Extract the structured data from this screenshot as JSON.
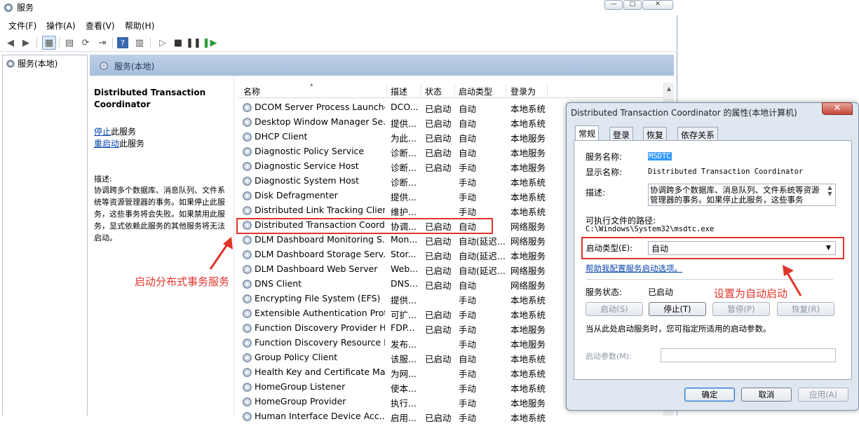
{
  "window": {
    "title": "服务",
    "buttons": [
      "—",
      "□",
      "✕"
    ]
  },
  "menu": [
    "文件(F)",
    "操作(A)",
    "查看(V)",
    "帮助(H)"
  ],
  "tree": {
    "root": "服务(本地)"
  },
  "content_header": "服务(本地)",
  "selected_service": {
    "title": "Distributed Transaction Coordinator",
    "stop_link": "停止",
    "stop_suffix": "此服务",
    "restart_link": "重启动",
    "restart_suffix": "此服务",
    "desc_label": "描述:",
    "desc_text": "协调跨多个数据库、消息队列、文件系统等资源管理器的事务。如果停止此服务，这些事务将会失败。如果禁用此服务，显式依赖此服务的其他服务将无法启动。"
  },
  "list": {
    "columns": [
      "名称",
      "描述",
      "状态",
      "启动类型",
      "登录为"
    ],
    "rows": [
      [
        "DCOM Server Process Launcher",
        "DCO...",
        "已启动",
        "自动",
        "本地系统"
      ],
      [
        "Desktop Window Manager Se...",
        "提供...",
        "已启动",
        "自动",
        "本地系统"
      ],
      [
        "DHCP Client",
        "为此...",
        "已启动",
        "自动",
        "本地服务"
      ],
      [
        "Diagnostic Policy Service",
        "诊断...",
        "已启动",
        "自动",
        "本地服务"
      ],
      [
        "Diagnostic Service Host",
        "诊断...",
        "已启动",
        "手动",
        "本地服务"
      ],
      [
        "Diagnostic System Host",
        "诊断...",
        "",
        "手动",
        "本地系统"
      ],
      [
        "Disk Defragmenter",
        "提供...",
        "",
        "手动",
        "本地系统"
      ],
      [
        "Distributed Link Tracking Client",
        "维护...",
        "",
        "手动",
        "本地系统"
      ],
      [
        "Distributed Transaction Coord...",
        "协调...",
        "已启动",
        "自动",
        "网络服务"
      ],
      [
        "DLM Dashboard Monitoring S...",
        "Mon...",
        "已启动",
        "自动(延迟...",
        "网络服务"
      ],
      [
        "DLM Dashboard Storage Serv...",
        "Stor...",
        "已启动",
        "自动(延迟...",
        "本地服务"
      ],
      [
        "DLM Dashboard Web Server",
        "Web...",
        "已启动",
        "自动(延迟...",
        "网络服务"
      ],
      [
        "DNS Client",
        "DNS...",
        "已启动",
        "自动",
        "网络服务"
      ],
      [
        "Encrypting File System (EFS)",
        "提供...",
        "",
        "手动",
        "本地系统"
      ],
      [
        "Extensible Authentication Prot...",
        "可扩...",
        "已启动",
        "手动",
        "本地系统"
      ],
      [
        "Function Discovery Provider H...",
        "FDP...",
        "已启动",
        "手动",
        "本地服务"
      ],
      [
        "Function Discovery Resource P...",
        "发布...",
        "",
        "手动",
        "本地服务"
      ],
      [
        "Group Policy Client",
        "该服...",
        "已启动",
        "自动",
        "本地系统"
      ],
      [
        "Health Key and Certificate Ma...",
        "为网...",
        "",
        "手动",
        "本地系统"
      ],
      [
        "HomeGroup Listener",
        "使本...",
        "",
        "手动",
        "本地系统"
      ],
      [
        "HomeGroup Provider",
        "执行...",
        "",
        "手动",
        "本地服务"
      ],
      [
        "Human Interface Device Acc...",
        "启用...",
        "已启动",
        "手动",
        "本地系统"
      ]
    ]
  },
  "annotation_left": "启动分布式事务服务",
  "annotation_right": "设置为自动启动",
  "dialog": {
    "title": "Distributed Transaction Coordinator 的属性(本地计算机)",
    "close": "✕",
    "tabs": [
      "常规",
      "登录",
      "恢复",
      "依存关系"
    ],
    "service_name_label": "服务名称:",
    "service_name": "MSDTC",
    "display_name_label": "显示名称:",
    "display_name": "Distributed Transaction Coordinator",
    "desc_label": "描述:",
    "desc": "协调跨多个数据库、消息队列、文件系统等资源管理器的事务。如果停止此服务，这些事务",
    "path_label": "可执行文件的路径:",
    "path": "C:\\Windows\\System32\\msdtc.exe",
    "startup_label": "启动类型(E):",
    "startup_value": "自动",
    "help_link": "帮助我配置服务启动选项。",
    "status_label": "服务状态:",
    "status_value": "已启动",
    "btn_start": "启动(S)",
    "btn_stop": "停止(T)",
    "btn_pause": "暂停(P)",
    "btn_resume": "恢复(R)",
    "hint": "当从此处启动服务时，您可指定所适用的启动参数。",
    "param_label": "启动参数(M):",
    "btn_ok": "确定",
    "btn_cancel": "取消",
    "btn_apply": "应用(A)"
  }
}
